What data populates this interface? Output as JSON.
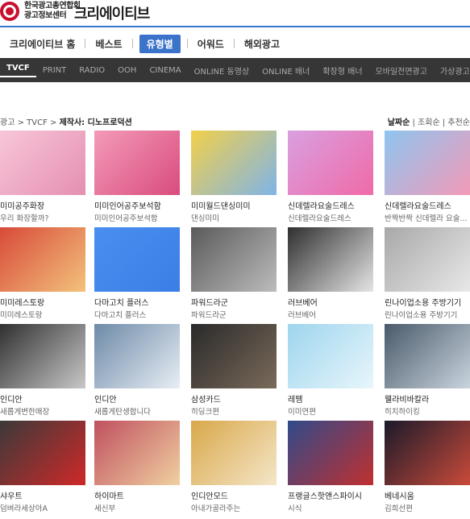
{
  "header": {
    "org_line1": "한국광고총연합회",
    "org_line2": "광고정보센터",
    "brand": "크리에이티브"
  },
  "main_nav": [
    "크리에이티브 홈",
    "베스트",
    "유형별",
    "어워드",
    "해외광고"
  ],
  "main_nav_active": "유형별",
  "sub_nav": [
    "TVCF",
    "PRINT",
    "RADIO",
    "OOH",
    "CINEMA",
    "ONLINE 동영상",
    "ONLINE 배너",
    "확장형 배너",
    "모바일전면광고",
    "가상광고"
  ],
  "sub_nav_active": "TVCF",
  "breadcrumb": {
    "prefix": "광고 > TVCF > ",
    "current": "제작사: 디노프로덕션"
  },
  "sort": {
    "active": "날짜순",
    "others": [
      "조회순",
      "추천순"
    ]
  },
  "colors": {
    "accent": "#3a73c9",
    "subnav_bg": "#363636",
    "logo_red": "#c8102e"
  },
  "items": [
    {
      "title": "미미공주화장",
      "sub": "우리 화장할까?",
      "colors": [
        "#f7c6d9",
        "#e58fb0"
      ]
    },
    {
      "title": "미미인어공주보석함",
      "sub": "미미인어공주보석함",
      "colors": [
        "#f39ab9",
        "#d94c7d"
      ]
    },
    {
      "title": "미미월드댄싱미미",
      "sub": "댄싱미미",
      "colors": [
        "#f2d04a",
        "#7fb4e8"
      ]
    },
    {
      "title": "신데렐라요술드레스",
      "sub": "신데렐라요술드레스",
      "colors": [
        "#d9a0e0",
        "#f06aa8"
      ]
    },
    {
      "title": "신데렐라요술드레스",
      "sub": "반짝반짝 신데렐라 요술...",
      "colors": [
        "#8ec5f0",
        "#f29ab8"
      ]
    },
    {
      "title": "미미레스토랑",
      "sub": "미미레스토랑",
      "colors": [
        "#d84a3a",
        "#f3c27b"
      ]
    },
    {
      "title": "다마고치 플러스",
      "sub": "다마고치 플러스",
      "colors": [
        "#4a8ef0",
        "#3b7fe6"
      ]
    },
    {
      "title": "파워드라군",
      "sub": "파워드라군",
      "colors": [
        "#5a5a5a",
        "#bcbcbc"
      ]
    },
    {
      "title": "러브베어",
      "sub": "러브베어",
      "colors": [
        "#2f2f2f",
        "#e5e5e5"
      ]
    },
    {
      "title": "린나이업소용 주방기기",
      "sub": "린나이업소용 주방기기",
      "colors": [
        "#a8a8a8",
        "#e8e8e8"
      ]
    },
    {
      "title": "인디안",
      "sub": "새롭게변한매장",
      "colors": [
        "#303030",
        "#c8c8c8"
      ]
    },
    {
      "title": "인디안",
      "sub": "새롭게탄생합니다",
      "colors": [
        "#6d8aa8",
        "#e8eef4"
      ]
    },
    {
      "title": "삼성카드",
      "sub": "히딩크편",
      "colors": [
        "#2a2a2a",
        "#7a6a5a"
      ]
    },
    {
      "title": "레뗌",
      "sub": "이미연편",
      "colors": [
        "#9ed5ee",
        "#e8f6fb"
      ]
    },
    {
      "title": "웰라비바칼라",
      "sub": "히치하이킹",
      "colors": [
        "#4a5a6a",
        "#c9d4de"
      ]
    },
    {
      "title": "샤우트",
      "sub": "덤벼라세상아A",
      "colors": [
        "#3a3a3a",
        "#d02828"
      ]
    },
    {
      "title": "하이마트",
      "sub": "세신부",
      "colors": [
        "#c05060",
        "#f0d0a0"
      ]
    },
    {
      "title": "인디안모드",
      "sub": "아내가골라주는",
      "colors": [
        "#d9a84a",
        "#f4e6c8"
      ]
    },
    {
      "title": "프랭글스핫앤스파이시",
      "sub": "시식",
      "colors": [
        "#304a8a",
        "#c03030"
      ]
    },
    {
      "title": "베네시움",
      "sub": "김희선편",
      "colors": [
        "#1a1a2a",
        "#c94a3a"
      ]
    }
  ]
}
